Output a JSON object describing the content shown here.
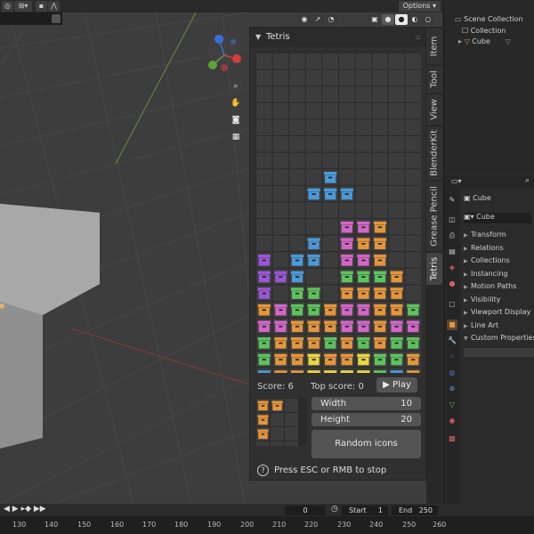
{
  "header": {
    "options_label": "Options"
  },
  "sidebar_tabs": [
    "Item",
    "Tool",
    "View",
    "BlenderKit",
    "Grease Pencil",
    "Tetris"
  ],
  "tetris": {
    "title": "Tetris",
    "score_label": "Score: 6",
    "top_score_label": "Top score: 0",
    "play_label": "Play",
    "width_label": "Width",
    "width_value": "10",
    "height_label": "Height",
    "height_value": "20",
    "random_icons_label": "Random icons",
    "hint": "Press ESC or RMB to stop"
  },
  "outliner": {
    "scene_collection": "Scene Collection",
    "collection": "Collection",
    "cube": "Cube"
  },
  "properties": {
    "object_name": "Cube",
    "data_name": "Cube",
    "panels": [
      "Transform",
      "Relations",
      "Collections",
      "Instancing",
      "Motion Paths",
      "Visibility",
      "Viewport Display",
      "Line Art",
      "Custom Properties"
    ]
  },
  "timeline": {
    "current_frame": "0",
    "start_label": "Start",
    "start_value": "1",
    "end_label": "End",
    "end_value": "250",
    "ruler_ticks": [
      "130",
      "140",
      "150",
      "160",
      "170",
      "180",
      "190",
      "200",
      "210",
      "220",
      "230",
      "240",
      "250",
      "260"
    ]
  },
  "colors": {
    "blue": "#4a9ad8",
    "purple": "#9a55d8",
    "pink": "#d266c6",
    "orange": "#e5953a",
    "green": "#5dc25d",
    "yellow": "#e8d840",
    "empty": "#3c3c3c"
  },
  "board": {
    "cols": 10,
    "rows": 20,
    "cells": [
      "..........",
      "..........",
      "..........",
      "..........",
      "..........",
      "..........",
      "..........",
      "....B.....",
      "...BBB....",
      "..........",
      ".....PPO..",
      "...B.POO..",
      "U.BB.PPO..",
      "UUB..GGGO.",
      "U.GG.OOOO.",
      "OPGGOPPOOG",
      "PPOOOPPOPP",
      "GOOOGOGOGG",
      "GOOYOOYGGO",
      "BOOYYYYGBO"
    ]
  },
  "next_piece": {
    "cols": 3,
    "rows": 4,
    "cells": [
      "OO.",
      "O..",
      "O..",
      "..."
    ]
  }
}
